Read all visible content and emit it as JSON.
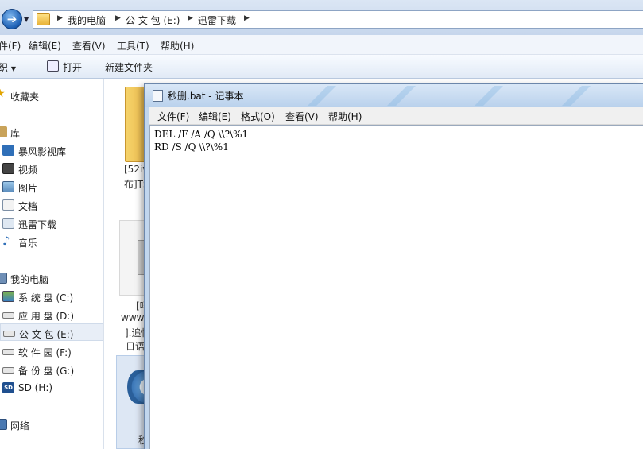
{
  "explorer": {
    "breadcrumb": [
      "我的电脑",
      "公 文 包 (E:)",
      "迅雷下载"
    ],
    "menu": [
      "件(F)",
      "编辑(E)",
      "查看(V)",
      "工具(T)",
      "帮助(H)"
    ],
    "toolbar": {
      "organize": "织",
      "open": "打开",
      "new_folder": "新建文件夹"
    },
    "nav": {
      "favorites": "收藏夹",
      "libraries": "库",
      "library_items": [
        "暴风影视库",
        "视频",
        "图片",
        "文档",
        "迅雷下载",
        "音乐"
      ],
      "computer": "我的电脑",
      "drives": [
        "系 统 盘 (C:)",
        "应 用 盘 (D:)",
        "公 文 包 (E:)",
        "软 件 园 (F:)",
        "备 份 盘 (G:)",
        "SD (H:)"
      ],
      "network": "网络"
    },
    "files": {
      "folder_name_line1": "[52iv",
      "folder_name_line2": "布]TS",
      "video_line1": "[吗",
      "video_line2": "www.",
      "video_line3": "].追忆",
      "video_line4": "日语",
      "bat_label": "秒"
    }
  },
  "notepad": {
    "title": "秒删.bat - 记事本",
    "menu": [
      "文件(F)",
      "编辑(E)",
      "格式(O)",
      "查看(V)",
      "帮助(H)"
    ],
    "content": [
      "DEL /F /A /Q \\\\?\\%1",
      "RD /S /Q \\\\?\\%1"
    ]
  },
  "colors": {
    "accent": "#1c5fb4",
    "title_bar": "#c1d6ee",
    "selection": "#e8eef7"
  }
}
